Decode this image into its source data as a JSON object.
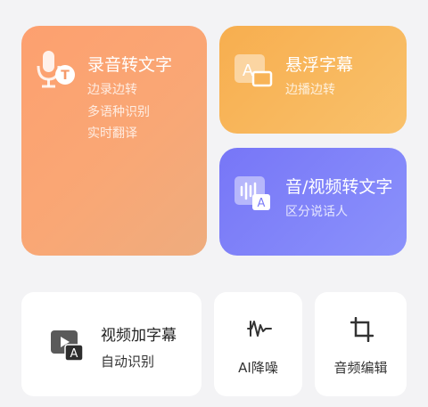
{
  "cards": {
    "record_to_text": {
      "title": "录音转文字",
      "lines": [
        "边录边转",
        "多语种识别",
        "实时翻译"
      ]
    },
    "floating_subtitle": {
      "title": "悬浮字幕",
      "subtitle": "边播边转"
    },
    "audio_video_to_text": {
      "title": "音/视频转文字",
      "subtitle": "区分说话人"
    },
    "video_subtitle": {
      "title": "视频加字幕",
      "subtitle": "自动识别"
    },
    "ai_denoise": {
      "label": "AI降噪"
    },
    "audio_edit": {
      "label": "音频编辑"
    }
  },
  "icons": {
    "record": "microphone-t-icon",
    "floating": "letter-a-window-icon",
    "audio_video": "waveform-a-icon",
    "video": "play-a-icon",
    "denoise": "waveform-denoise-icon",
    "edit": "crop-icon"
  },
  "colors": {
    "record_card": "#fda06f",
    "floating_card": "#f7ae4f",
    "audio_video_card": "#7776f7",
    "background": "#f3f3f5"
  }
}
